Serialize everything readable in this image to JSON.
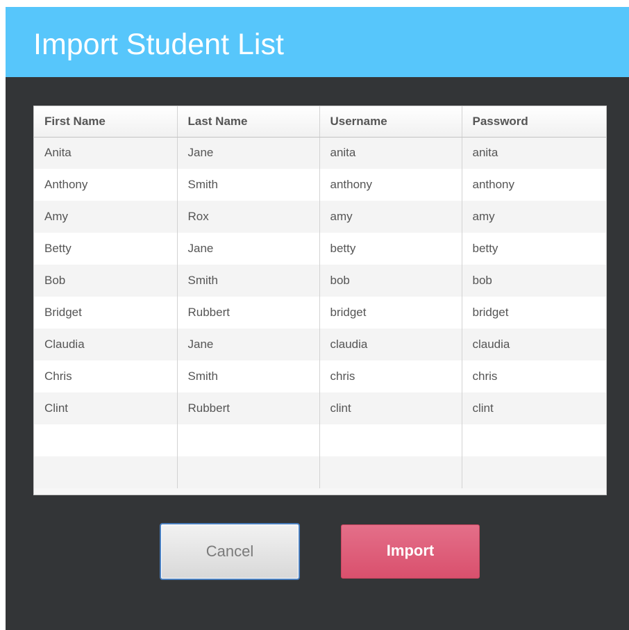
{
  "dialog": {
    "title": "Import Student List",
    "colors": {
      "title_bar": "#57c6fb",
      "body": "#333537",
      "import_button": "#dc5873"
    }
  },
  "table": {
    "headers": [
      "First Name",
      "Last Name",
      "Username",
      "Password"
    ],
    "rows": [
      [
        "Anita",
        "Jane",
        "anita",
        "anita"
      ],
      [
        "Anthony",
        "Smith",
        "anthony",
        "anthony"
      ],
      [
        "Amy",
        "Rox",
        "amy",
        "amy"
      ],
      [
        "Betty",
        "Jane",
        "betty",
        "betty"
      ],
      [
        "Bob",
        "Smith",
        "bob",
        "bob"
      ],
      [
        "Bridget",
        "Rubbert",
        "bridget",
        "bridget"
      ],
      [
        "Claudia",
        "Jane",
        "claudia",
        "claudia"
      ],
      [
        "Chris",
        "Smith",
        "chris",
        "chris"
      ],
      [
        "Clint",
        "Rubbert",
        "clint",
        "clint"
      ]
    ]
  },
  "buttons": {
    "cancel": "Cancel",
    "import": "Import"
  }
}
